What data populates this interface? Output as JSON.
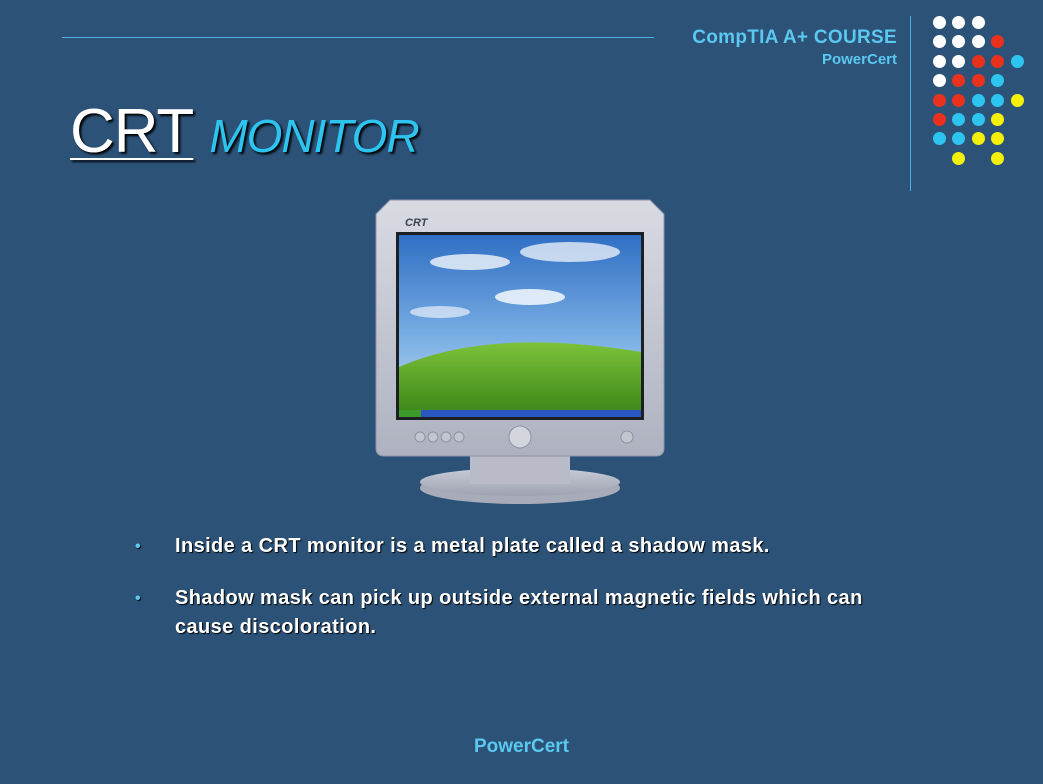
{
  "header": {
    "course_title": "CompTIA A+ COURSE",
    "course_subtitle": "PowerCert"
  },
  "slide": {
    "title_main": "CRT",
    "title_accent": "MONITOR",
    "monitor_brand": "CRT",
    "bullets": [
      "Inside a CRT monitor is a metal plate called a shadow mask.",
      "Shadow mask can pick up outside external magnetic fields which can cause discoloration."
    ]
  },
  "footer": {
    "brand": "PowerCert"
  },
  "colors": {
    "background": "#2c5278",
    "accent": "#2ec4f0",
    "dot_white": "#ffffff",
    "dot_red": "#e8321e",
    "dot_blue": "#2ec4f0",
    "dot_yellow": "#f4f00a"
  },
  "decoration": {
    "dot_grid_rows": [
      [
        "white",
        "white",
        "white"
      ],
      [
        "white",
        "white",
        "white",
        "red"
      ],
      [
        "white",
        "white",
        "red",
        "red",
        "blue"
      ],
      [
        "white",
        "red",
        "red",
        "blue"
      ],
      [
        "red",
        "red",
        "blue",
        "blue",
        "yellow"
      ],
      [
        "red",
        "blue",
        "blue",
        "yellow"
      ],
      [
        "blue",
        "blue",
        "yellow",
        "yellow"
      ],
      [
        "",
        "yellow",
        "",
        "yellow"
      ]
    ]
  }
}
